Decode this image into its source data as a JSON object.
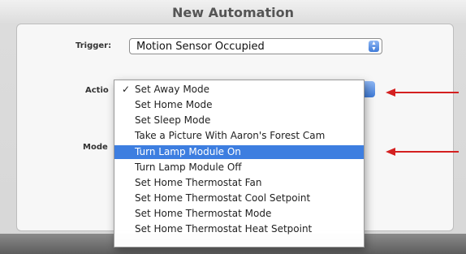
{
  "window": {
    "title": "New Automation"
  },
  "form": {
    "trigger_label": "Trigger:",
    "trigger_value": "Motion Sensor Occupied",
    "action_label": "Actio",
    "mode_label": "Mode"
  },
  "menu": {
    "check_mark": "✓",
    "items": [
      {
        "label": "Set Away Mode",
        "checked": true
      },
      {
        "label": "Set Home Mode"
      },
      {
        "label": "Set Sleep Mode"
      },
      {
        "label": "Take a Picture With Aaron's Forest Cam"
      },
      {
        "label": "Turn Lamp Module On",
        "highlighted": true
      },
      {
        "label": "Turn Lamp Module Off"
      },
      {
        "label": "Set Home Thermostat Fan"
      },
      {
        "label": "Set Home Thermostat Cool Setpoint"
      },
      {
        "label": "Set Home Thermostat Mode"
      },
      {
        "label": "Set Home Thermostat Heat Setpoint"
      }
    ]
  },
  "colors": {
    "highlight": "#3d7ee0",
    "annotation_arrow": "#d42020"
  }
}
